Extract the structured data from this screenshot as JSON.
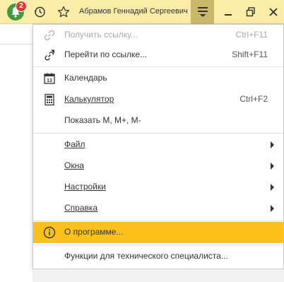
{
  "titlebar": {
    "notification_count": "2",
    "user_name": "Абрамов Геннадий Сергеевич",
    "icons": {
      "bell": "bell-icon",
      "history": "history-icon",
      "favorites": "star-icon",
      "menu": "hamburger-menu-icon",
      "minimize": "minimize-icon",
      "restore": "restore-icon",
      "close": "close-icon"
    },
    "colors": {
      "background": "#fbeca8",
      "menu_active": "#c9b86a",
      "badge": "#e03a2b",
      "bell": "#3f9b3f"
    }
  },
  "menu": {
    "highlight_color": "#fcc21b",
    "items": [
      {
        "label": "Получить ссылку...",
        "shortcut": "Ctrl+F11",
        "icon": "link-icon",
        "state": "disabled"
      },
      {
        "label": "Перейти по ссылке...",
        "shortcut": "Shift+F11",
        "icon": "go-to-link-icon",
        "state": "enabled"
      },
      {
        "label": "Календарь",
        "icon": "calendar-icon",
        "state": "enabled"
      },
      {
        "label": "Калькулятор",
        "shortcut": "Ctrl+F2",
        "icon": "calculator-icon",
        "state": "enabled"
      },
      {
        "label": "Показать M, M+, M-",
        "state": "enabled"
      },
      {
        "label": "Файл",
        "submenu": true
      },
      {
        "label": "Окна",
        "submenu": true
      },
      {
        "label": "Настройки",
        "submenu": true
      },
      {
        "label": "Справка",
        "submenu": true
      },
      {
        "label": "О программе...",
        "icon": "info-icon",
        "state": "highlighted"
      },
      {
        "label": "Функции для технического специалиста...",
        "state": "enabled"
      }
    ]
  }
}
